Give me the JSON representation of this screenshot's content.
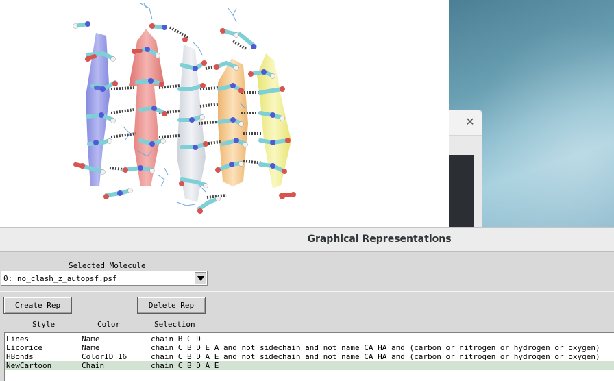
{
  "background_window": {
    "close_glyph": "✕"
  },
  "viewer": {
    "chain_colors": {
      "C": "#8f93e6",
      "B": "#e87c78",
      "D": "#d9dde6",
      "A": "#f4c37c",
      "E": "#f1ef86"
    }
  },
  "panel": {
    "title": "Graphical Representations",
    "selected_molecule_label": "Selected Molecule",
    "selected_molecule_value": "0: no_clash_z_autopsf.psf",
    "create_rep_label": "Create Rep",
    "delete_rep_label": "Delete Rep",
    "columns": {
      "style": "Style",
      "color": "Color",
      "selection": "Selection"
    },
    "reps": [
      {
        "style": "Lines",
        "color": "Name",
        "selection": "chain B C D"
      },
      {
        "style": "Licorice",
        "color": "Name",
        "selection": "chain C B D E A and not sidechain and not name CA HA and (carbon or nitrogen or hydrogen or oxygen)"
      },
      {
        "style": "HBonds",
        "color": "ColorID 16",
        "selection": "chain C B D A E and not sidechain and not name CA HA and (carbon or nitrogen or hydrogen or oxygen)"
      },
      {
        "style": "NewCartoon",
        "color": "Chain",
        "selection": "chain C B D A E"
      }
    ],
    "selected_rep_index": 3
  }
}
